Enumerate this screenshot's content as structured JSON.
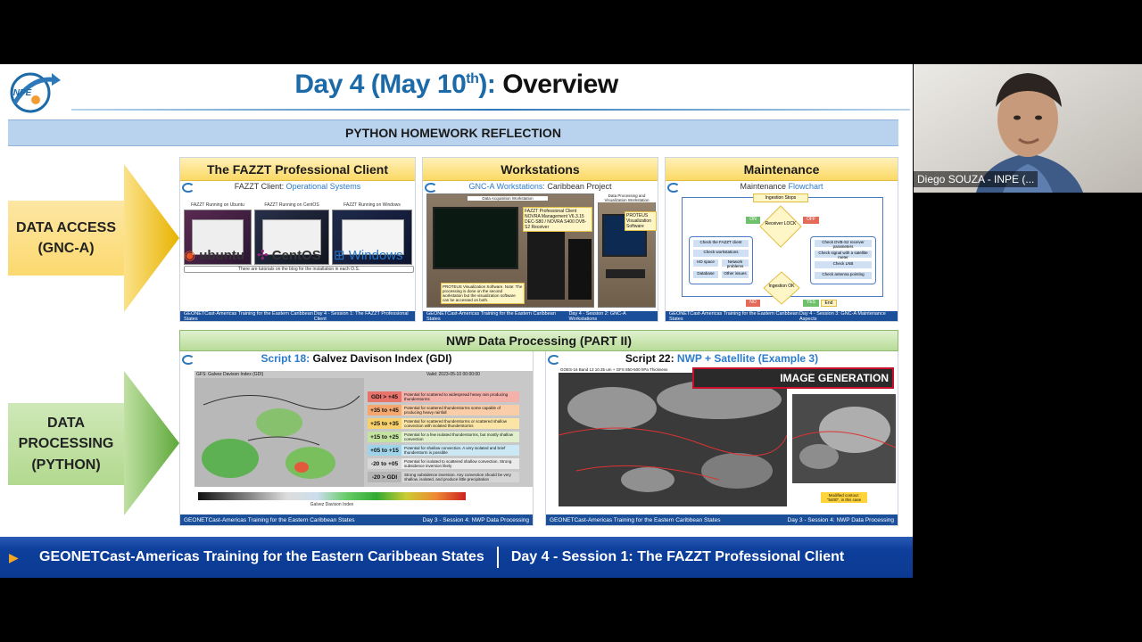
{
  "slide": {
    "title_main": "Day 4 (May 10",
    "title_sup": "th",
    "title_close": "):",
    "title_dark": "Overview",
    "logo_text": "INPE",
    "banner": "PYTHON HOMEWORK REFLECTION",
    "left_labels": {
      "access": "DATA ACCESS\n(GNC-A)",
      "processing": "DATA\nPROCESSING\n(PYTHON)"
    },
    "panels": {
      "fazzt": {
        "head": "The FAZZT Professional Client",
        "sub_prefix": "FAZZT Client:",
        "sub_blue": "Operational Systems",
        "screen_labels": [
          "FAZZT Running on Ubuntu",
          "FAZZT Running on CentOS",
          "FAZZT Running on Windows"
        ],
        "os_names": [
          "ubuntu",
          "CentOS",
          "Windows"
        ],
        "note": "There are tutorials on the blog for the installation in each O.S.",
        "footer_left": "GEONETCast-Americas Training for the Eastern Caribbean States",
        "footer_right": "Day 4 - Session 1: The FAZZT Professional Client"
      },
      "workstations": {
        "head": "Workstations",
        "sub_blue": "GNC-A Workstations:",
        "sub_suffix": "Caribbean Project",
        "label_acq": "Data Acquisition Workstation",
        "label_vis": "Data Processing and Visualization Workstation",
        "specs": [
          "FAZZT Professional Client",
          "NOVRA Management V6.3.15",
          "DEC-S80 / NOVRA S400 DVB-S2 Receiver"
        ],
        "protheus_tag": "PROTEUS Visualization Software",
        "note": "PROTEUS Visualization Software. Note: The processing is done on the second workstation but the visualization software can be accessed on both.",
        "footer_left": "GEONETCast-Americas Training for the Eastern Caribbean States",
        "footer_right": "Day 4 - Session 2: GNC-A Workstations"
      },
      "maintenance": {
        "head": "Maintenance",
        "sub_prefix": "Maintenance",
        "sub_blue": "Flowchart",
        "nodes": {
          "ingestion": "Ingestion Stops",
          "on": "ON",
          "off": "OFF",
          "receiver": "Receiver LOCK",
          "ingestion_ok": "Ingestion OK",
          "no": "NO",
          "yes": "YES",
          "end": "End"
        },
        "left_steps": [
          "Check the FAZZT client",
          "Check workstations",
          "HD space",
          "Network problems",
          "Database",
          "Other issues"
        ],
        "right_steps": [
          "Check DVB-S2 receiver parameters",
          "Check signal with a satellite meter",
          "Check LNB",
          "Check antenna pointing"
        ],
        "footer_left": "GEONETCast-Americas Training for the Eastern Caribbean States",
        "footer_right": "Day 4 - Session 3: GNC-A Maintenance Aspects"
      },
      "nwp": {
        "head": "NWP Data Processing (PART II)",
        "script18_prefix": "Script 18:",
        "script18_name": "Galvez Davison Index (GDI)",
        "script18_map_title": "GFS: Galvez Davison Index (GDI)",
        "script18_valid": "Valid: 2023-05-10 00:00:00",
        "gdi_rows": [
          {
            "k": "GDI > +45",
            "v": "Potential for scattered to widespread heavy rain producing thunderstorms",
            "color": "#e8736b"
          },
          {
            "k": "+35 to +45",
            "v": "Potential for scattered thunderstorms some capable of producing heavy rainfall",
            "color": "#f4a870"
          },
          {
            "k": "+25 to +35",
            "v": "Potential for scattered thunderstorms or scattered shallow convection with isolated thunderstorms",
            "color": "#f7d06b"
          },
          {
            "k": "+15 to +25",
            "v": "Potential for a few isolated thunderstorms, but mostly shallow convection",
            "color": "#c5e3a0"
          },
          {
            "k": "+05 to +15",
            "v": "Potential for shallow convection. A very isolated and brief thunderstorm is possible",
            "color": "#9fd3ea"
          },
          {
            "k": "-20 to +05",
            "v": "Potential for isolated to scattered shallow convection. Strong subsidence inversion likely",
            "color": "#d8d8d8"
          },
          {
            "k": "-20 > GDI",
            "v": "Strong subsidence inversion. Any convection should be very shallow, isolated, and produce little precipitation",
            "color": "#b5b5b5"
          }
        ],
        "script18_colorbar_label": "Galvez Davison Index",
        "script22_prefix": "Script 22:",
        "script22_name": "NWP + Satellite (Example 3)",
        "script22_map_title": "GOES-16 Band 13 10.35 um + GFS 850-500 hPa Thickness",
        "image_generation": "IMAGE GENERATION",
        "modified_contour": "Modified contour: \"5400\", in this case",
        "footer_left_18": "GEONETCast-Americas Training for the Eastern Caribbean States",
        "footer_right_18": "Day 3 - Session 4: NWP Data Processing",
        "footer_left_22": "GEONETCast-Americas Training for the Eastern Caribbean States",
        "footer_right_22": "Day 3 - Session 4: NWP Data Processing"
      }
    },
    "bottom_bar": {
      "left": "GEONETCast-Americas Training for the Eastern Caribbean States",
      "right": "Day 4 - Session 1: The FAZZT Professional Client"
    }
  },
  "webcam": {
    "participant_name": "Diego SOUZA - INPE (..."
  },
  "colors": {
    "title_blue": "#1d6aa8",
    "banner_blue": "#b9d3ee",
    "access_yellow": "#fbd96f",
    "processing_green": "#b2d98f",
    "bar_blue": "#0b3a91",
    "image_gen_red": "#c8102e"
  }
}
